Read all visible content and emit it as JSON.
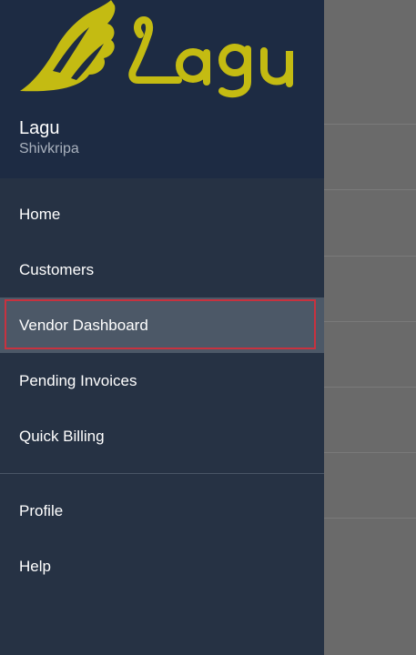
{
  "brand": {
    "logo_text": "Lagu",
    "logo_color": "#c4bb12"
  },
  "user": {
    "name": "Lagu",
    "subtitle": "Shivkripa"
  },
  "menu": {
    "items": [
      {
        "label": "Home"
      },
      {
        "label": "Customers"
      },
      {
        "label": "Vendor Dashboard",
        "selected": true
      },
      {
        "label": "Pending Invoices"
      },
      {
        "label": "Quick Billing"
      }
    ],
    "secondary": [
      {
        "label": "Profile"
      },
      {
        "label": "Help"
      }
    ]
  },
  "colors": {
    "drawer_bg": "#263244",
    "header_bg": "#1d2b43",
    "active_bg": "#4c5867",
    "highlight": "#c8323f",
    "scrim": "#6a6a6a"
  }
}
